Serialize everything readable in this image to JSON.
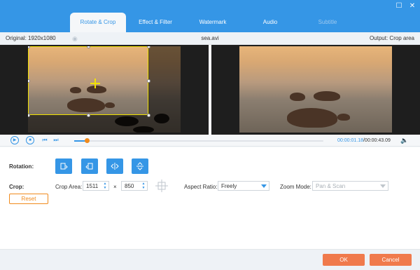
{
  "tabs": [
    {
      "label": "Rotate & Crop"
    },
    {
      "label": "Effect & Filter"
    },
    {
      "label": "Watermark"
    },
    {
      "label": "Audio"
    },
    {
      "label": "Subtitle"
    }
  ],
  "infobar": {
    "original": "Original: 1920x1080",
    "filename": "sea.avi",
    "output": "Output: Crop area"
  },
  "playback": {
    "current_time": "00:00:01.18",
    "total_time": "/00:00:43.09",
    "progress": 0.05
  },
  "controls": {
    "rotation_label": "Rotation:",
    "crop_label": "Crop:",
    "crop_area_label": "Crop Area:",
    "crop_width": "1511",
    "crop_height": "850",
    "times_sign": "×",
    "aspect_label": "Aspect Ratio:",
    "aspect_value": "Freely",
    "zoom_label": "Zoom Mode:",
    "zoom_value": "Pan & Scan",
    "reset_label": "Reset"
  },
  "footer": {
    "ok_label": "OK",
    "cancel_label": "Cancel"
  },
  "colors": {
    "accent": "#3596e6",
    "orange": "#f08a1c",
    "button": "#f07a4c",
    "crop_frame": "#f1e200"
  }
}
